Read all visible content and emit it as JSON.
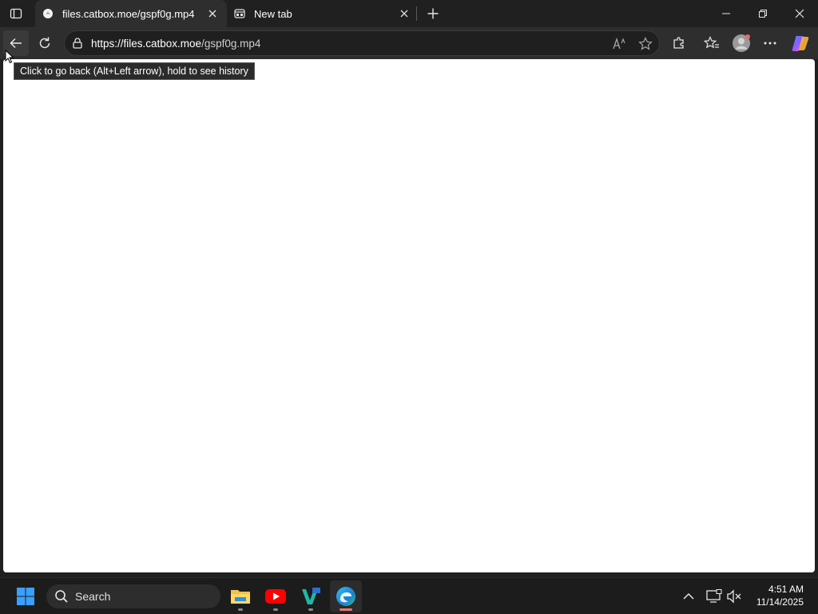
{
  "browser": {
    "tabs": [
      {
        "title": "files.catbox.moe/gspf0g.mp4",
        "active": true,
        "favicon": "catbox-favicon"
      },
      {
        "title": "New tab",
        "active": false,
        "favicon": "new-tab-icon"
      }
    ],
    "address": {
      "url_host": "https://files.catbox.moe",
      "url_path": "/gspf0g.mp4"
    },
    "tooltip": "Click to go back (Alt+Left arrow), hold to see history"
  },
  "taskbar": {
    "search_label": "Search",
    "apps": [
      "file-explorer-icon",
      "youtube-icon",
      "vscode-like-icon",
      "edge-icon"
    ],
    "time": "4:51 AM",
    "date": "11/14/2025"
  },
  "colors": {
    "chrome_bg": "#202020",
    "toolbar_bg": "#2e2e2e",
    "content_bg": "#ffffff",
    "taskbar_bg": "#1c1c1c",
    "accent_windows": "#3aa0ff"
  }
}
